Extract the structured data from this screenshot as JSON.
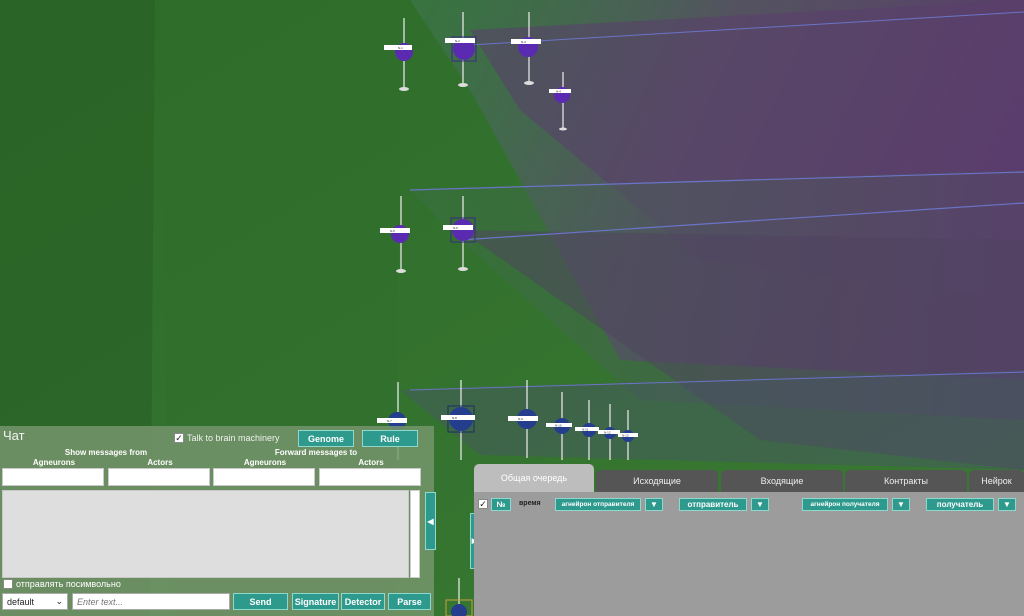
{
  "scene": {
    "neuron_labels": [
      "N-1",
      "N-2",
      "N-3",
      "N-4",
      "N-5",
      "N-6",
      "N-7",
      "N-8",
      "N-9",
      "N-10",
      "N-11",
      "N-12",
      "N-13"
    ]
  },
  "chat": {
    "title": "Чат",
    "talk_label": "Talk to brain machinery",
    "talk_checked": "✓",
    "genome_label": "Genome",
    "rule_label": "Rule",
    "show_title": "Show messages from",
    "forward_title": "Forward messages to",
    "col_agneurons_1": "Agneurons",
    "col_actors_1": "Actors",
    "col_agneurons_2": "Agneurons",
    "col_actors_2": "Actors",
    "collapse_icon": "◀",
    "send_by_char_label": "отправлять посимвольно",
    "select_value": "default",
    "select_arrow": "⌄",
    "input_placeholder": "Enter text...",
    "send_label": "Send",
    "signature_label": "Signature",
    "detector_label": "Detector",
    "parse_label": "Parse"
  },
  "queue": {
    "expand_icon": "▶",
    "tabs": [
      "Общая очередь",
      "Исходящие",
      "Входящие",
      "Контракты",
      "Нейрок"
    ],
    "header": {
      "check": "✓",
      "num_label": "№",
      "time_label": "время",
      "sender_agneuron": "агнейрон отправителя",
      "sender": "отправитель",
      "receiver_agneuron": "агнейрон получателя",
      "receiver": "получатель",
      "filter_icon": "▼"
    }
  },
  "colors": {
    "background_green": "#2f6b2a",
    "teal_button": "#2e9a8e",
    "neuron_purple": "#5a2bb0",
    "neuron_blue": "#243d8c"
  }
}
